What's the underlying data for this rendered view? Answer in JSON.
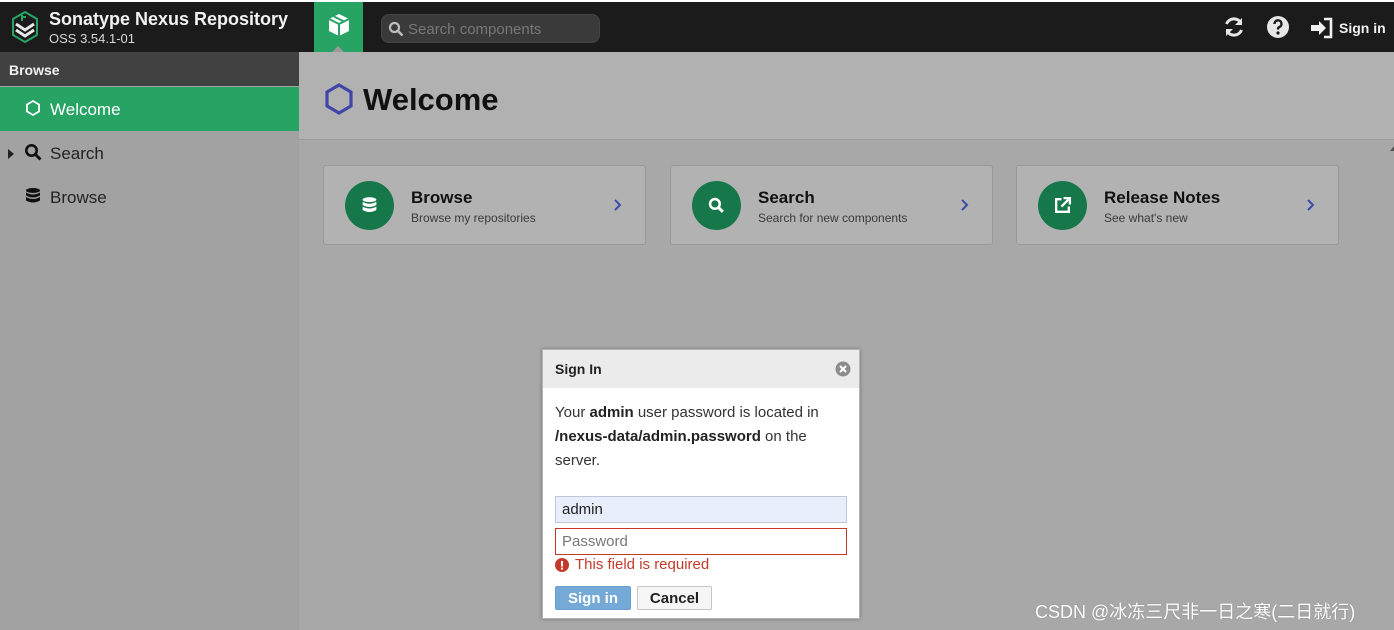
{
  "header": {
    "title": "Sonatype Nexus Repository",
    "version": "OSS 3.54.1-01",
    "search_placeholder": "Search components",
    "signin_label": "Sign in"
  },
  "sidebar": {
    "section": "Browse",
    "items": [
      {
        "label": "Welcome",
        "icon": "hexagon-icon",
        "active": true
      },
      {
        "label": "Search",
        "icon": "search-icon",
        "expandable": true
      },
      {
        "label": "Browse",
        "icon": "database-icon"
      }
    ]
  },
  "main": {
    "title": "Welcome",
    "cards": [
      {
        "title": "Browse",
        "subtitle": "Browse my repositories",
        "icon": "database-icon"
      },
      {
        "title": "Search",
        "subtitle": "Search for new components",
        "icon": "search-icon"
      },
      {
        "title": "Release Notes",
        "subtitle": "See what's new",
        "icon": "external-link-icon"
      }
    ]
  },
  "dialog": {
    "title": "Sign In",
    "msg_prefix": "Your ",
    "msg_user": "admin",
    "msg_mid": " user password is located in ",
    "msg_path": "/nexus-data/admin.password",
    "msg_suffix": " on the server.",
    "username_value": "admin",
    "password_placeholder": "Password",
    "error": "This field is required",
    "signin_button": "Sign in",
    "cancel_button": "Cancel"
  },
  "watermark": "CSDN @冰冻三尺非一日之寒(二日就行)",
  "colors": {
    "brand_green": "#27a364",
    "card_icon_green": "#16784a",
    "error_red": "#c23b2a",
    "primary_button": "#74a9d8"
  }
}
